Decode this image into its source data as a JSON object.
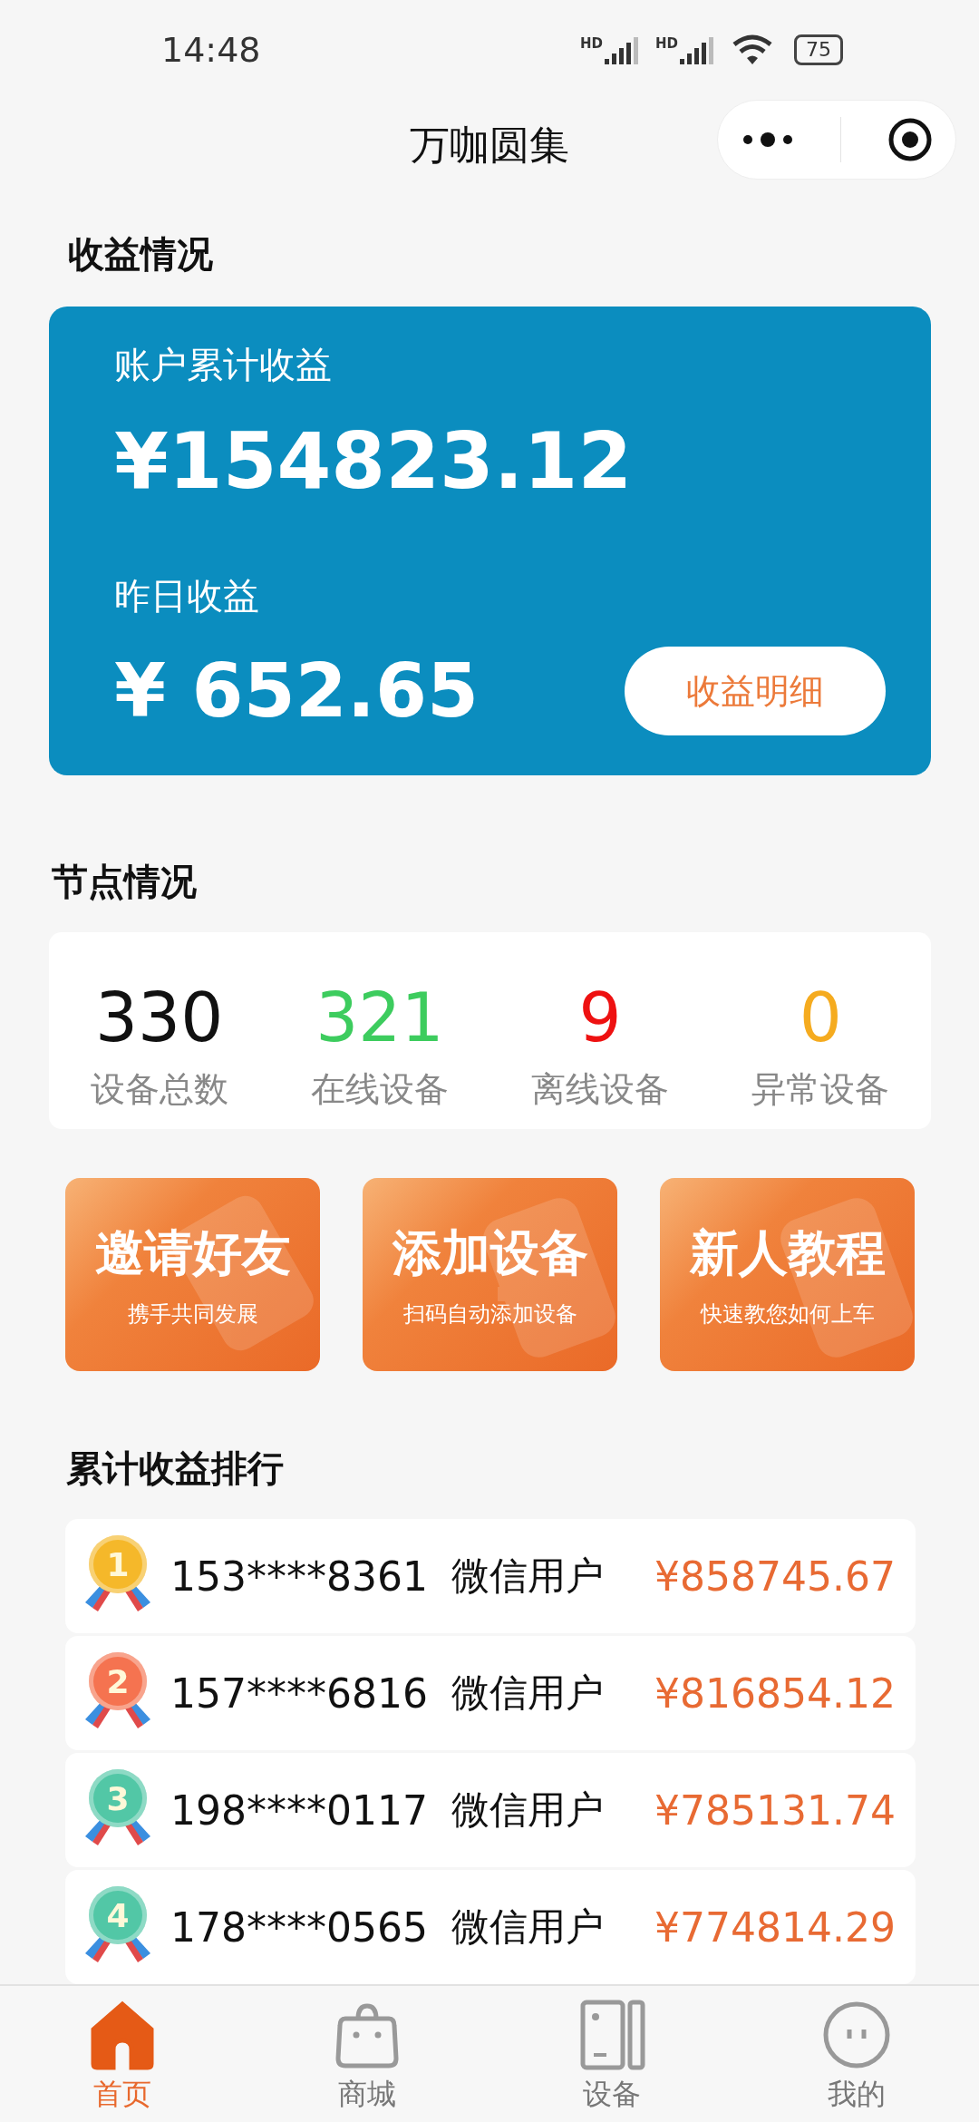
{
  "status_bar": {
    "time": "14:48",
    "sim_labels": [
      "HD",
      "HD"
    ],
    "battery": "75"
  },
  "title_bar": {
    "title": "万咖圆集"
  },
  "earnings": {
    "heading": "收益情况",
    "total_label": "账户累计收益",
    "total": "¥154823.12",
    "yesterday_label": "昨日收益",
    "yesterday": "¥ 652.65",
    "detail_button": "收益明细"
  },
  "nodes": {
    "heading": "节点情况",
    "stats": [
      {
        "value": "330",
        "label": "设备总数",
        "color": "#111111"
      },
      {
        "value": "321",
        "label": "在线设备",
        "color": "#3dcc5e"
      },
      {
        "value": "9",
        "label": "离线设备",
        "color": "#ee1111"
      },
      {
        "value": "0",
        "label": "异常设备",
        "color": "#f5ab1f"
      }
    ]
  },
  "actions": [
    {
      "title": "邀请好友",
      "subtitle": "携手共同发展"
    },
    {
      "title": "添加设备",
      "subtitle": "扫码自动添加设备"
    },
    {
      "title": "新人教程",
      "subtitle": "快速教您如何上车"
    }
  ],
  "ranking": {
    "heading": "累计收益排行",
    "rows": [
      {
        "rank": "1",
        "color": "#f5b82a",
        "phone": "153****8361",
        "name": "微信用户",
        "amount": "¥858745.67"
      },
      {
        "rank": "2",
        "color": "#f57350",
        "phone": "157****6816",
        "name": "微信用户",
        "amount": "¥816854.12"
      },
      {
        "rank": "3",
        "color": "#52c7a6",
        "phone": "198****0117",
        "name": "微信用户",
        "amount": "¥785131.74"
      },
      {
        "rank": "4",
        "color": "#52c7a6",
        "phone": "178****0565",
        "name": "微信用户",
        "amount": "¥774814.29"
      }
    ]
  },
  "tab_bar": [
    {
      "label": "首页",
      "selected": true
    },
    {
      "label": "商城",
      "selected": false
    },
    {
      "label": "设备",
      "selected": false
    },
    {
      "label": "我的",
      "selected": false
    }
  ]
}
